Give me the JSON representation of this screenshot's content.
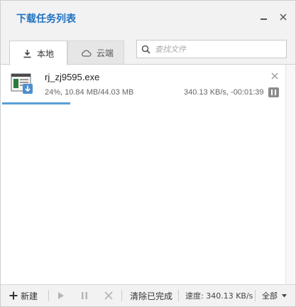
{
  "window": {
    "title": "下载任务列表"
  },
  "tabs": [
    {
      "label": "本地",
      "icon": "download-icon",
      "active": true
    },
    {
      "label": "云端",
      "icon": "cloud-icon",
      "active": false
    }
  ],
  "search": {
    "placeholder": "查找文件",
    "value": ""
  },
  "downloads": [
    {
      "filename": "rj_zj9595.exe",
      "info": "24%, 10.84 MB/44.03 MB",
      "speed_eta": "340.13 KB/s, -00:01:39",
      "progress": 0.24,
      "state_icon": "pause-icon"
    }
  ],
  "bottombar": {
    "new_label": "新建",
    "clear_label": "清除已完成",
    "speed_text": "速度: 340.13 KB/s",
    "filter_label": "全部"
  },
  "colors": {
    "accent": "#1e73c4",
    "progress": "#5a9fd6",
    "disabled_icon": "#b5b5b5"
  }
}
